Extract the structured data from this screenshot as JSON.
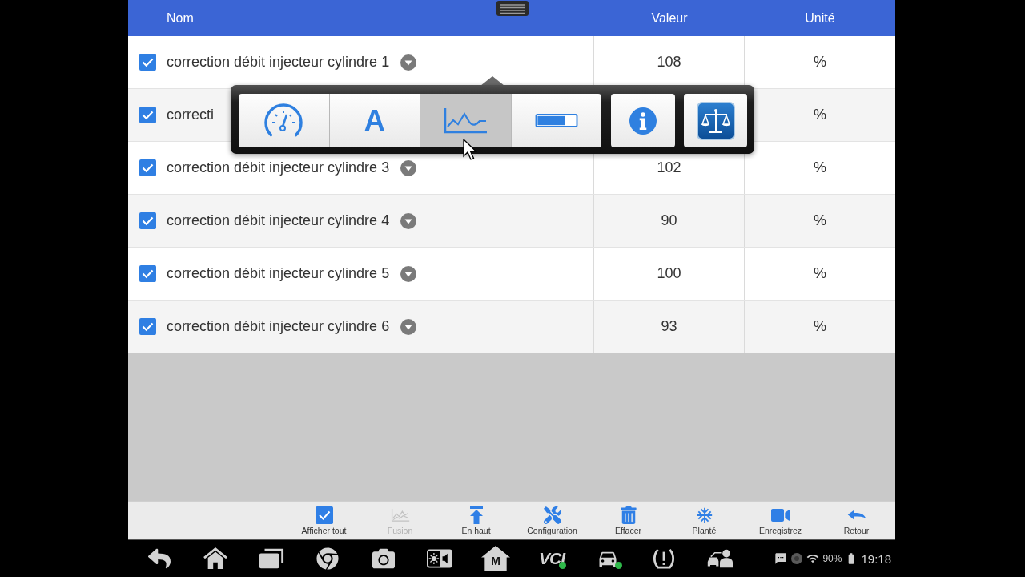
{
  "header": {
    "columns": [
      "Nom",
      "Valeur",
      "Unité"
    ]
  },
  "rows": [
    {
      "name": "correction débit injecteur cylindre 1",
      "checked": true,
      "dropdown": true,
      "value": "108",
      "unit": "%"
    },
    {
      "name": "correcti",
      "checked": true,
      "dropdown": false,
      "unit": "%"
    },
    {
      "name": "correction débit injecteur cylindre 3",
      "checked": true,
      "dropdown": true,
      "value": "102",
      "unit": "%"
    },
    {
      "name": "correction débit injecteur cylindre 4",
      "checked": true,
      "dropdown": true,
      "value": "90",
      "unit": "%"
    },
    {
      "name": "correction débit injecteur cylindre 5",
      "checked": true,
      "dropdown": true,
      "value": "100",
      "unit": "%"
    },
    {
      "name": "correction débit injecteur cylindre 6",
      "checked": true,
      "dropdown": true,
      "value": "93",
      "unit": "%"
    }
  ],
  "popup": {
    "buttons": [
      {
        "kind": "gauge",
        "selected": false
      },
      {
        "kind": "text",
        "label": "A",
        "selected": false
      },
      {
        "kind": "graph",
        "selected": true
      },
      {
        "kind": "bar",
        "selected": false
      },
      {
        "kind": "info",
        "selected": false
      },
      {
        "kind": "scale",
        "selected": false
      }
    ]
  },
  "toolbar": [
    {
      "kind": "show-all",
      "label": "Afficher tout",
      "disabled": false
    },
    {
      "kind": "merge",
      "label": "Fusion",
      "disabled": true
    },
    {
      "kind": "top",
      "label": "En haut",
      "disabled": false
    },
    {
      "kind": "config",
      "label": "Configuration",
      "disabled": false
    },
    {
      "kind": "delete",
      "label": "Effacer",
      "disabled": false
    },
    {
      "kind": "freeze",
      "label": "Planté",
      "disabled": false
    },
    {
      "kind": "record",
      "label": "Enregistrez",
      "disabled": false
    },
    {
      "kind": "back",
      "label": "Retour",
      "disabled": false
    }
  ],
  "nav": [
    {
      "kind": "back"
    },
    {
      "kind": "home"
    },
    {
      "kind": "recents"
    },
    {
      "kind": "browser"
    },
    {
      "kind": "camera"
    },
    {
      "kind": "display"
    },
    {
      "kind": "m-home",
      "label": "M"
    },
    {
      "kind": "vci",
      "label": "VCI",
      "connected": true
    },
    {
      "kind": "car",
      "connected": true
    },
    {
      "kind": "tpms"
    },
    {
      "kind": "remote"
    }
  ],
  "status": {
    "battery": "90%",
    "time": "19:18"
  }
}
